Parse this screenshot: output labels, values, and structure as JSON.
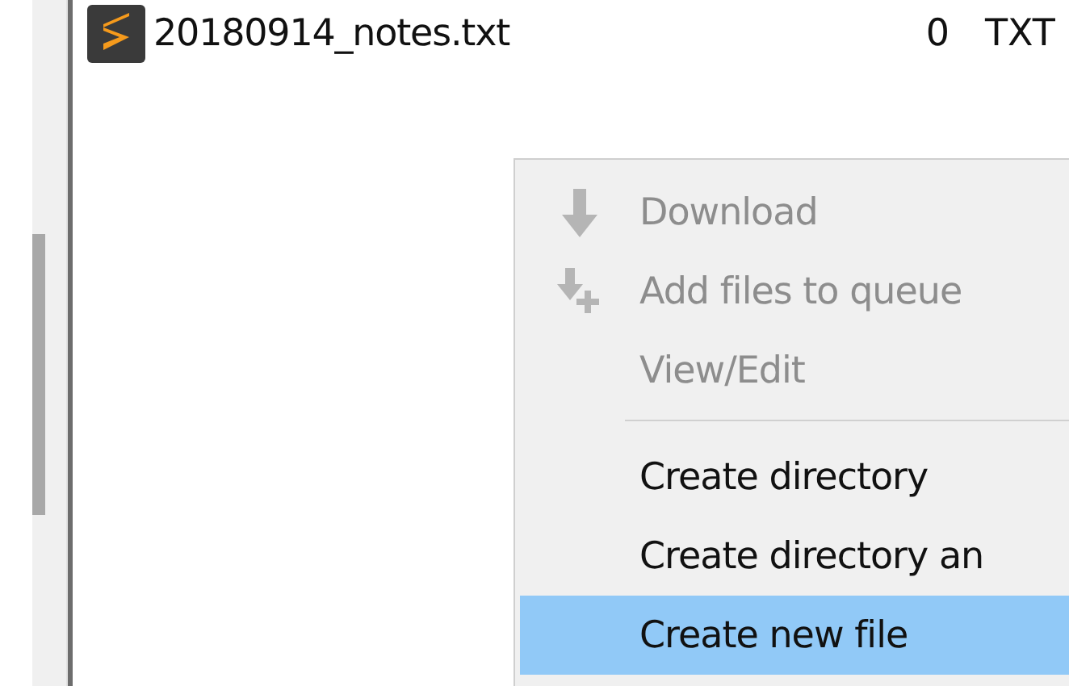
{
  "file_list": {
    "rows": [
      {
        "name": "20180914_notes.txt",
        "size": "0",
        "type": "TXT"
      }
    ]
  },
  "context_menu": {
    "items": [
      {
        "kind": "item",
        "label": "Download",
        "disabled": true,
        "selected": false
      },
      {
        "kind": "item",
        "label": "Add files to queue",
        "disabled": true,
        "selected": false
      },
      {
        "kind": "item",
        "label": "View/Edit",
        "disabled": true,
        "selected": false
      },
      {
        "kind": "separator"
      },
      {
        "kind": "item",
        "label": "Create directory",
        "disabled": false,
        "selected": false
      },
      {
        "kind": "item",
        "label": "Create directory an",
        "disabled": false,
        "selected": false
      },
      {
        "kind": "item",
        "label": "Create new file",
        "disabled": false,
        "selected": true
      }
    ]
  }
}
